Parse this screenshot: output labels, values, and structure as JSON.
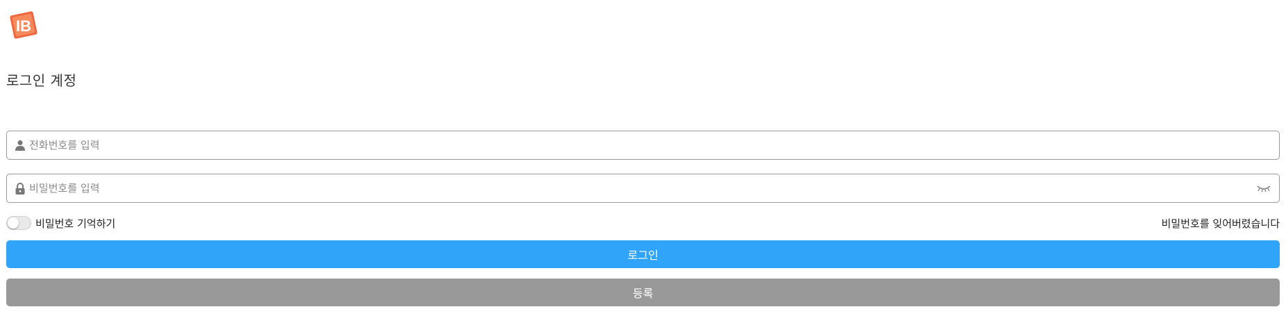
{
  "brand": {
    "logo_icon": "ib-logo-icon",
    "accent": "#f0673f"
  },
  "header": {
    "title": "로그인 계정"
  },
  "form": {
    "phone": {
      "placeholder": "전화번호를 입력",
      "value": "",
      "icon": "user-icon"
    },
    "password": {
      "placeholder": "비밀번호를 입력",
      "value": "",
      "icon": "lock-icon",
      "toggle_icon": "eye-closed-icon"
    },
    "remember": {
      "label": "비밀번호 기억하기",
      "checked": false
    },
    "forgot_label": "비밀번호를 잊어버렸습니다",
    "login_label": "로그인",
    "register_label": "등록"
  },
  "colors": {
    "primary": "#2fa4f9",
    "secondary": "#999999"
  }
}
